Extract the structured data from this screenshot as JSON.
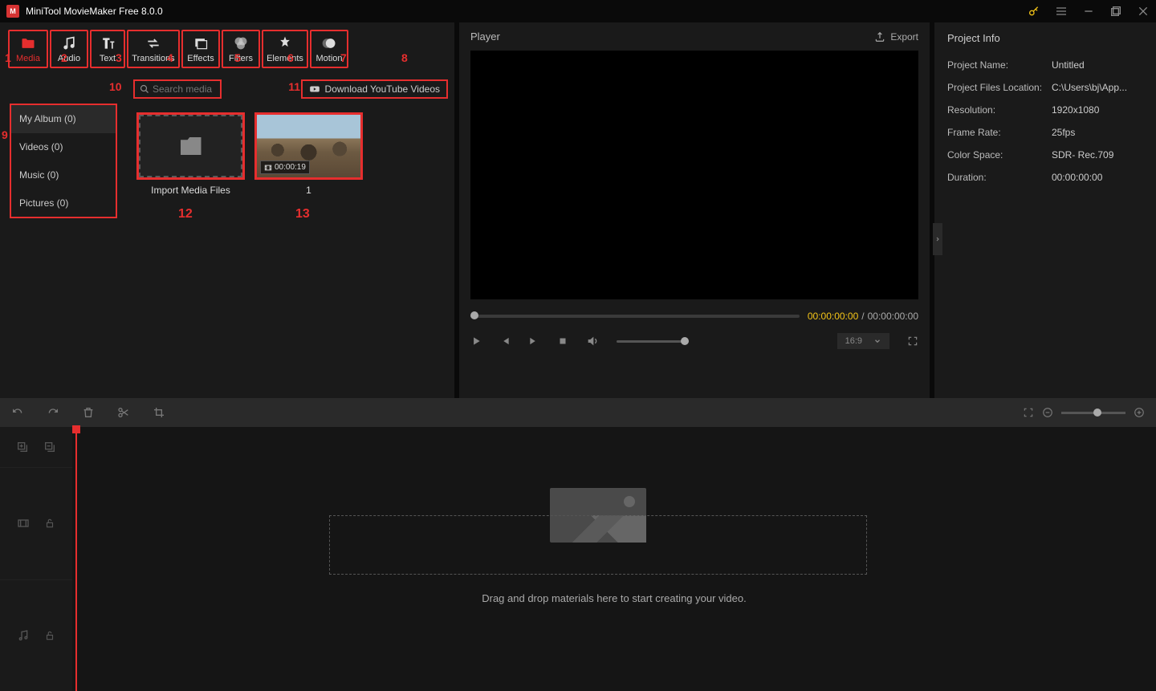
{
  "app": {
    "title": "MiniTool MovieMaker Free 8.0.0"
  },
  "toolbar": {
    "items": [
      {
        "label": "Media",
        "num": "1"
      },
      {
        "label": "Audio",
        "num": "2"
      },
      {
        "label": "Text",
        "num": "3"
      },
      {
        "label": "Transitions",
        "num": "4"
      },
      {
        "label": "Effects",
        "num": "5"
      },
      {
        "label": "Filters",
        "num": "6"
      },
      {
        "label": "Elements",
        "num": "7"
      },
      {
        "label": "Motion",
        "num": "8"
      }
    ]
  },
  "search": {
    "placeholder": "Search media",
    "num": "10"
  },
  "download_btn": {
    "label": "Download YouTube Videos",
    "num": "11"
  },
  "sidebar": {
    "num": "9",
    "items": [
      {
        "label": "My Album (0)"
      },
      {
        "label": "Videos (0)"
      },
      {
        "label": "Music (0)"
      },
      {
        "label": "Pictures (0)"
      }
    ]
  },
  "grid": {
    "import": {
      "label": "Import Media Files",
      "num": "12"
    },
    "clip1": {
      "label": "1",
      "duration": "00:00:19",
      "num": "13"
    }
  },
  "player": {
    "title": "Player",
    "export": "Export",
    "time_current": "00:00:00:00",
    "time_sep": " / ",
    "time_total": "00:00:00:00",
    "ratio": "16:9"
  },
  "info": {
    "title": "Project Info",
    "rows": [
      {
        "k": "Project Name:",
        "v": "Untitled"
      },
      {
        "k": "Project Files Location:",
        "v": "C:\\Users\\bj\\App..."
      },
      {
        "k": "Resolution:",
        "v": "1920x1080"
      },
      {
        "k": "Frame Rate:",
        "v": "25fps"
      },
      {
        "k": "Color Space:",
        "v": "SDR- Rec.709"
      },
      {
        "k": "Duration:",
        "v": "00:00:00:00"
      }
    ]
  },
  "timeline": {
    "drop_text": "Drag and drop materials here to start creating your video."
  }
}
